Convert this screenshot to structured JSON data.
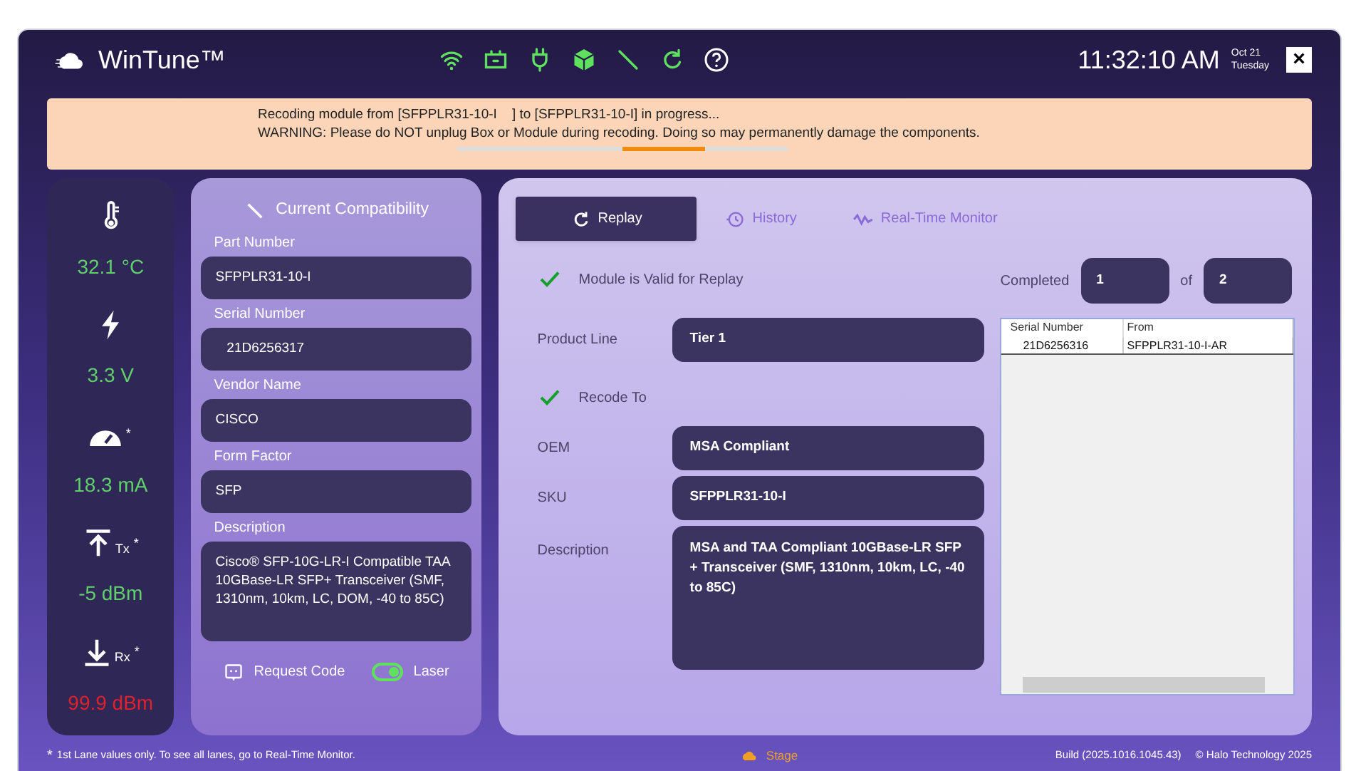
{
  "header": {
    "app_name": "WinTune™",
    "time": "11:32:10 AM",
    "date": "Oct 21",
    "day": "Tuesday",
    "close": "×"
  },
  "banner": {
    "lines": [
      "Recoding module from [SFPPLR31-10-I    ] to [SFPPLR31-10-I] in progress...",
      "WARNING: Please do NOT unplug Box or Module during recoding. Doing so may permanently damage the components."
    ]
  },
  "sensors": [
    {
      "kind": "temperature",
      "value": "32.1 °C",
      "color": "#5fd06a"
    },
    {
      "kind": "voltage",
      "value": "3.3 V",
      "color": "#5fd06a"
    },
    {
      "kind": "current",
      "mark": "*",
      "value": "18.3 mA",
      "color": "#5fd06a"
    },
    {
      "kind": "tx",
      "sub": "Tx",
      "mark": "*",
      "value": "-5 dBm",
      "color": "#5fd06a"
    },
    {
      "kind": "rx",
      "sub": "Rx",
      "mark": "*",
      "value": "99.9 dBm",
      "color": "#e0202a"
    }
  ],
  "compatibility": {
    "title": "Current Compatibility",
    "fields": [
      {
        "label": "Part Number",
        "value": "SFPPLR31-10-I"
      },
      {
        "label": "Serial Number",
        "value": "   21D6256317"
      },
      {
        "label": "Vendor Name",
        "value": "CISCO"
      },
      {
        "label": "Form Factor",
        "value": "SFP"
      },
      {
        "label": "Description",
        "value": "Cisco® SFP-10G-LR-I Compatible TAA 10GBase-LR SFP+ Transceiver (SMF, 1310nm, 10km, LC, DOM, -40 to 85C)",
        "multiline": true
      }
    ],
    "request_code": "Request Code",
    "laser": {
      "label": "Laser",
      "on": true
    }
  },
  "main": {
    "tabs": [
      {
        "label": "Replay",
        "selected": true,
        "kind": "replay"
      },
      {
        "label": "History",
        "selected": false,
        "kind": "history"
      },
      {
        "label": "Real-Time Monitor",
        "selected": false,
        "kind": "monitor"
      }
    ],
    "valid": {
      "label": "Module is Valid for Replay",
      "checked": true
    },
    "completed": {
      "label": "Completed",
      "done": "1",
      "of": "of",
      "total": "2"
    },
    "product_line": {
      "label": "Product Line",
      "value": "Tier 1"
    },
    "recode_to": {
      "label": "Recode To",
      "checked": true
    },
    "fields": [
      {
        "label": "OEM",
        "value": "MSA Compliant"
      },
      {
        "label": "SKU",
        "value": "SFPPLR31-10-I"
      },
      {
        "label": "Description",
        "value": "MSA and TAA Compliant 10GBase-LR SFP + Transceiver (SMF, 1310nm, 10km, LC, -40 to 85C)",
        "multiline": true
      }
    ],
    "table": {
      "columns": [
        "Serial Number",
        "From"
      ],
      "rows": [
        [
          "21D6256316",
          "SFPPLR31-10-I-AR"
        ]
      ]
    }
  },
  "footer": {
    "mark": "*",
    "note": "1st Lane values only. To see all lanes, go to Real-Time Monitor.",
    "stage": "Stage",
    "build": "Build (2025.1016.1045.43)",
    "copyright": "© Halo Technology 2025"
  }
}
